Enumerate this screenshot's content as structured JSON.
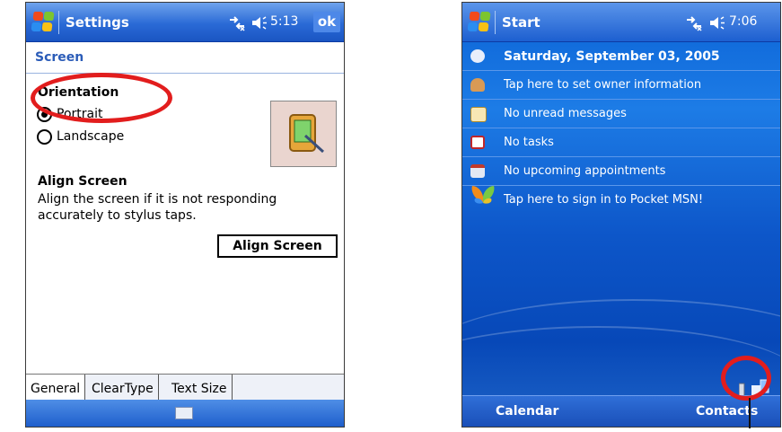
{
  "left_screen": {
    "app_title": "Settings",
    "time": "5:13",
    "ok_label": "ok",
    "section_header": "Screen",
    "orientation_heading": "Orientation",
    "portrait_label": "Portrait",
    "landscape_label": "Landscape",
    "orientation_selected": "Portrait",
    "align_heading": "Align Screen",
    "align_description": "Align the screen if it is not responding accurately to stylus taps.",
    "align_button_label": "Align Screen",
    "tabs": [
      "General",
      "ClearType",
      "Text Size"
    ],
    "active_tab": "General",
    "icons": [
      "windows-flag-icon",
      "connectivity-icon",
      "volume-icon",
      "keyboard-icon"
    ]
  },
  "right_screen": {
    "app_title": "Start",
    "time": "7:06",
    "today_items": [
      {
        "icon": "clock-icon",
        "text": "Saturday, September 03, 2005"
      },
      {
        "icon": "owner-icon",
        "text": "Tap here to set owner information"
      },
      {
        "icon": "envelope-icon",
        "text": "No unread messages"
      },
      {
        "icon": "tasks-icon",
        "text": "No tasks"
      },
      {
        "icon": "calendar-icon",
        "text": "No upcoming appointments"
      },
      {
        "icon": "msn-butterfly-icon",
        "text": "Tap here to sign in to Pocket MSN!"
      }
    ],
    "softkey_left": "Calendar",
    "softkey_right": "Contacts"
  },
  "colors": {
    "title_bar_blue": "#2a6ad6",
    "highlight_red": "#e21d1d",
    "header_text_blue": "#2b5cb8",
    "today_background": "#0d56c9"
  }
}
